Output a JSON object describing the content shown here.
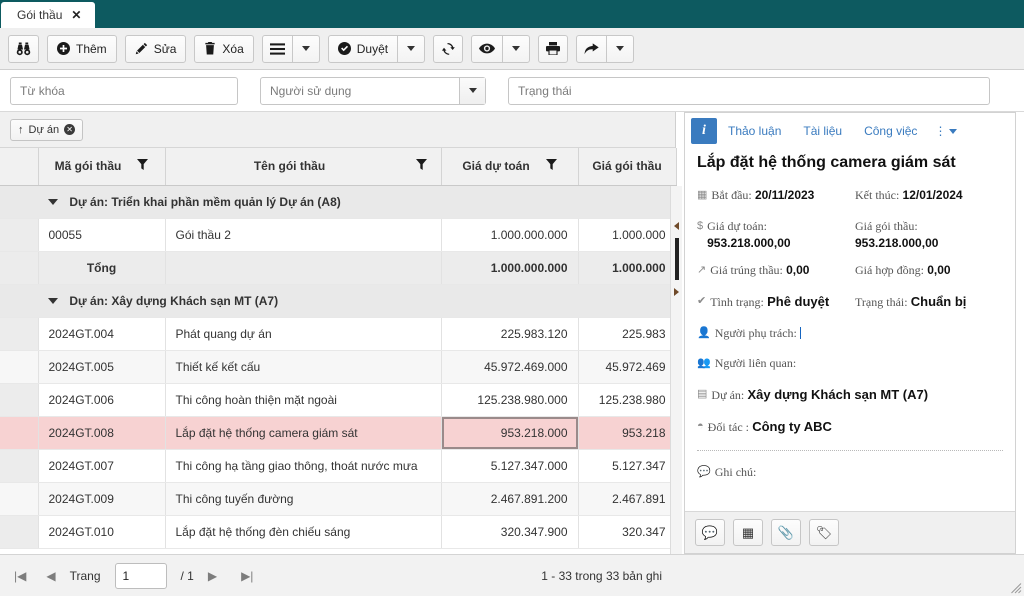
{
  "tab": {
    "label": "Gói thầu",
    "close_icon": "close-icon"
  },
  "toolbar": {
    "search_icon": "binoculars-icon",
    "add_label": "Thêm",
    "edit_label": "Sửa",
    "delete_label": "Xóa",
    "menu_icon": "hamburger-icon",
    "approve_label": "Duyệt",
    "refresh_icon": "refresh-icon",
    "view_icon": "eye-icon",
    "print_icon": "print-icon",
    "share_icon": "share-arrow-icon",
    "caret_icon": "chevron-down-icon"
  },
  "filters": {
    "keyword_placeholder": "Từ khóa",
    "user_placeholder": "Người sử dụng",
    "status_placeholder": "Trạng thái"
  },
  "group_chip": {
    "label": "Dự án",
    "sort_icon": "sort-asc-icon",
    "remove_icon": "remove-icon"
  },
  "grid": {
    "columns": [
      {
        "label": "Mã gói thầu",
        "filter": true
      },
      {
        "label": "Tên gói thầu",
        "filter": true
      },
      {
        "label": "Giá dự toán",
        "filter": true
      },
      {
        "label": "Giá gói thầu",
        "filter": false
      }
    ],
    "groups": [
      {
        "title": "Dự án: Triển khai phần mềm quản lý Dự án (A8)",
        "rows": [
          {
            "code": "00055",
            "name": "Gói thầu 2",
            "estimate": "1.000.000.000",
            "package": "1.000.000"
          }
        ],
        "total": {
          "label": "Tổng",
          "estimate": "1.000.000.000",
          "package": "1.000.000"
        }
      },
      {
        "title": "Dự án: Xây dựng Khách sạn MT (A7)",
        "rows": [
          {
            "code": "2024GT.004",
            "name": "Phát quang dự án",
            "estimate": "225.983.120",
            "package": "225.983"
          },
          {
            "code": "2024GT.005",
            "name": "Thiết kế kết cấu",
            "estimate": "45.972.469.000",
            "package": "45.972.469"
          },
          {
            "code": "2024GT.006",
            "name": "Thi công hoàn thiện mặt ngoài",
            "estimate": "125.238.980.000",
            "package": "125.238.980"
          },
          {
            "code": "2024GT.008",
            "name": "Lắp đặt hệ thống camera giám sát",
            "estimate": "953.218.000",
            "package": "953.218",
            "selected": true
          },
          {
            "code": "2024GT.007",
            "name": "Thi công hạ tầng giao thông, thoát nước mưa",
            "estimate": "5.127.347.000",
            "package": "5.127.347"
          },
          {
            "code": "2024GT.009",
            "name": "Thi công tuyến đường",
            "estimate": "2.467.891.200",
            "package": "2.467.891"
          },
          {
            "code": "2024GT.010",
            "name": "Lắp đặt hệ thống đèn chiếu sáng",
            "estimate": "320.347.900",
            "package": "320.347"
          }
        ]
      }
    ]
  },
  "pager": {
    "first_icon": "first-page-icon",
    "prev_icon": "prev-page-icon",
    "page_label": "Trang",
    "page_value": "1",
    "total_pages": "/ 1",
    "next_icon": "next-page-icon",
    "last_icon": "last-page-icon",
    "record_summary": "1 - 33 trong 33 bản ghi"
  },
  "detail": {
    "info_icon": "info-icon",
    "tabs": [
      {
        "label": "Thảo luận"
      },
      {
        "label": "Tài liệu"
      },
      {
        "label": "Công việc"
      }
    ],
    "more_icon": "kebab-menu-icon",
    "title": "Lắp đặt hệ thống camera giám sát",
    "fields": [
      {
        "icon": "calendar-icon",
        "label": "Bắt đầu:",
        "value": "20/11/2023",
        "r_label": "Kết thúc:",
        "r_value": "12/01/2024"
      },
      {
        "icon": "dollar-icon",
        "label": "Giá dự toán:",
        "value": "953.218.000,00",
        "r_label": "Giá gói thầu:",
        "r_value": "953.218.000,00",
        "wrap": true
      },
      {
        "icon": "arrow-up-right-icon",
        "label": "Giá trúng thầu:",
        "value": "0,00",
        "r_label": "Giá hợp đồng:",
        "r_value": "0,00"
      },
      {
        "icon": "check-icon",
        "label": "Tình trạng:",
        "value": "Phê duyệt",
        "r_label": "Trạng thái:",
        "r_value": "Chuẩn bị",
        "big": true
      }
    ],
    "single_fields": [
      {
        "icon": "user-icon",
        "label": "Người phụ trách:",
        "value": "",
        "cursor": true
      },
      {
        "icon": "user-add-icon",
        "label": "Người liên quan:",
        "value": ""
      },
      {
        "icon": "project-icon",
        "label": "Dự án:",
        "value": "Xây dựng Khách sạn MT (A7)",
        "big": true
      },
      {
        "icon": "partner-icon",
        "label": "Đối tác :",
        "value": "Công ty ABC",
        "big": true
      }
    ],
    "note": {
      "icon": "comment-icon",
      "label": "Ghi chú:"
    },
    "footer_buttons": [
      {
        "icon": "comment-icon"
      },
      {
        "icon": "calendar-icon"
      },
      {
        "icon": "paperclip-icon"
      },
      {
        "icon": "tag-icon"
      }
    ]
  },
  "colors": {
    "header_teal": "#0d5a60",
    "accent_blue": "#3a7bbf",
    "selected_row": "#f7d2d2"
  }
}
